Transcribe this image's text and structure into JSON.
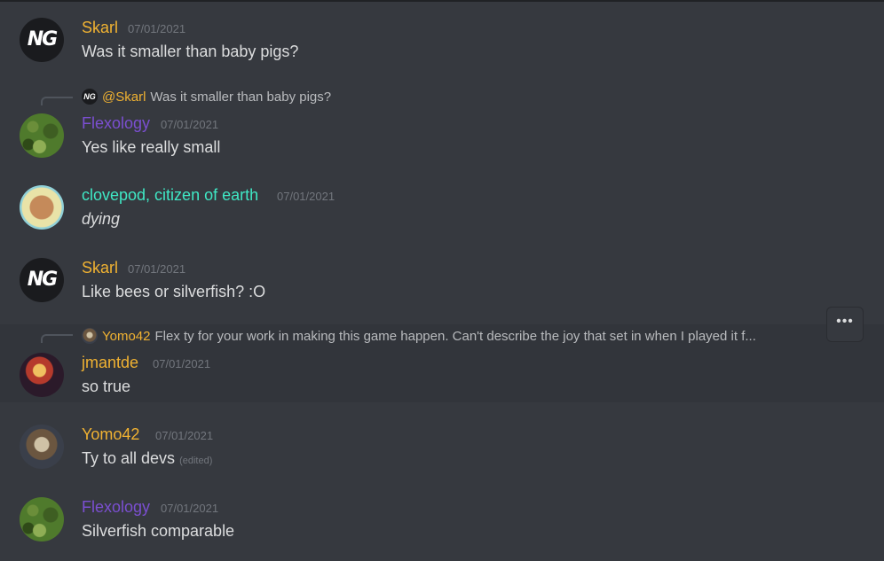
{
  "colors": {
    "background": "#36393f",
    "skarl": "#f0b232",
    "flexology": "#7b4fd1",
    "clovepod": "#3fe8c5",
    "jmantde": "#f0b232",
    "yomo42": "#f0b232"
  },
  "messages": [
    {
      "user": "Skarl",
      "avatar_icon": "ng-logo-avatar",
      "avatar_text": "NG",
      "timestamp": "07/01/2021",
      "text": "Was it smaller than baby pigs?"
    },
    {
      "reply": {
        "avatar_text": "NG",
        "user": "@Skarl",
        "text": "Was it smaller than baby pigs?"
      },
      "user": "Flexology",
      "avatar_icon": "pixel-leaf-avatar",
      "timestamp": "07/01/2021",
      "text": "Yes like really small"
    },
    {
      "user": "clovepod, citizen of earth",
      "avatar_icon": "pixel-character-avatar",
      "timestamp": "07/01/2021",
      "text": "dying"
    },
    {
      "user": "Skarl",
      "avatar_icon": "ng-logo-avatar",
      "avatar_text": "NG",
      "timestamp": "07/01/2021",
      "text": "Like bees or silverfish? :O"
    },
    {
      "reply": {
        "user": "Yomo42",
        "text": "Flex ty for your work in making this game happen. Can't describe the joy that set in when I played it f..."
      },
      "user": "jmantde",
      "avatar_icon": "anime-character-avatar",
      "timestamp": "07/01/2021",
      "text": "so true"
    },
    {
      "user": "Yomo42",
      "avatar_icon": "character-avatar",
      "timestamp": "07/01/2021",
      "text": "Ty to all devs",
      "edited": "(edited)"
    },
    {
      "user": "Flexology",
      "avatar_icon": "pixel-leaf-avatar",
      "timestamp": "07/01/2021",
      "text": "Silverfish comparable"
    }
  ],
  "toolbar": {
    "more_label": "•••",
    "more_icon": "more-options-icon"
  }
}
